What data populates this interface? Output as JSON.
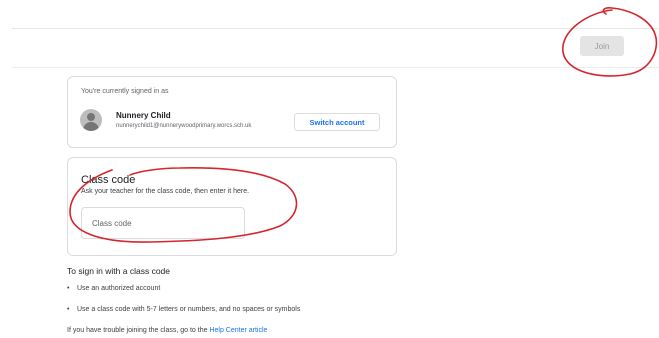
{
  "header": {
    "join_label": "Join"
  },
  "account": {
    "signed_in_label": "You're currently signed in as",
    "name": "Nunnery Child",
    "email": "nunnerychild1@nunnerywoodprimary.worcs.sch.uk",
    "switch_label": "Switch account"
  },
  "class_code": {
    "title": "Class code",
    "description": "Ask your teacher for the class code, then enter it here.",
    "placeholder": "Class code"
  },
  "help": {
    "title": "To sign in with a class code",
    "bullets": [
      "Use an authorized account",
      "Use a class code with 5-7 letters or numbers, and no spaces or symbols"
    ],
    "trouble_text": "If you have trouble joining the class, go to the ",
    "link_text": "Help Center article"
  },
  "colors": {
    "annotation": "#d6252d",
    "link": "#1a73e8"
  }
}
